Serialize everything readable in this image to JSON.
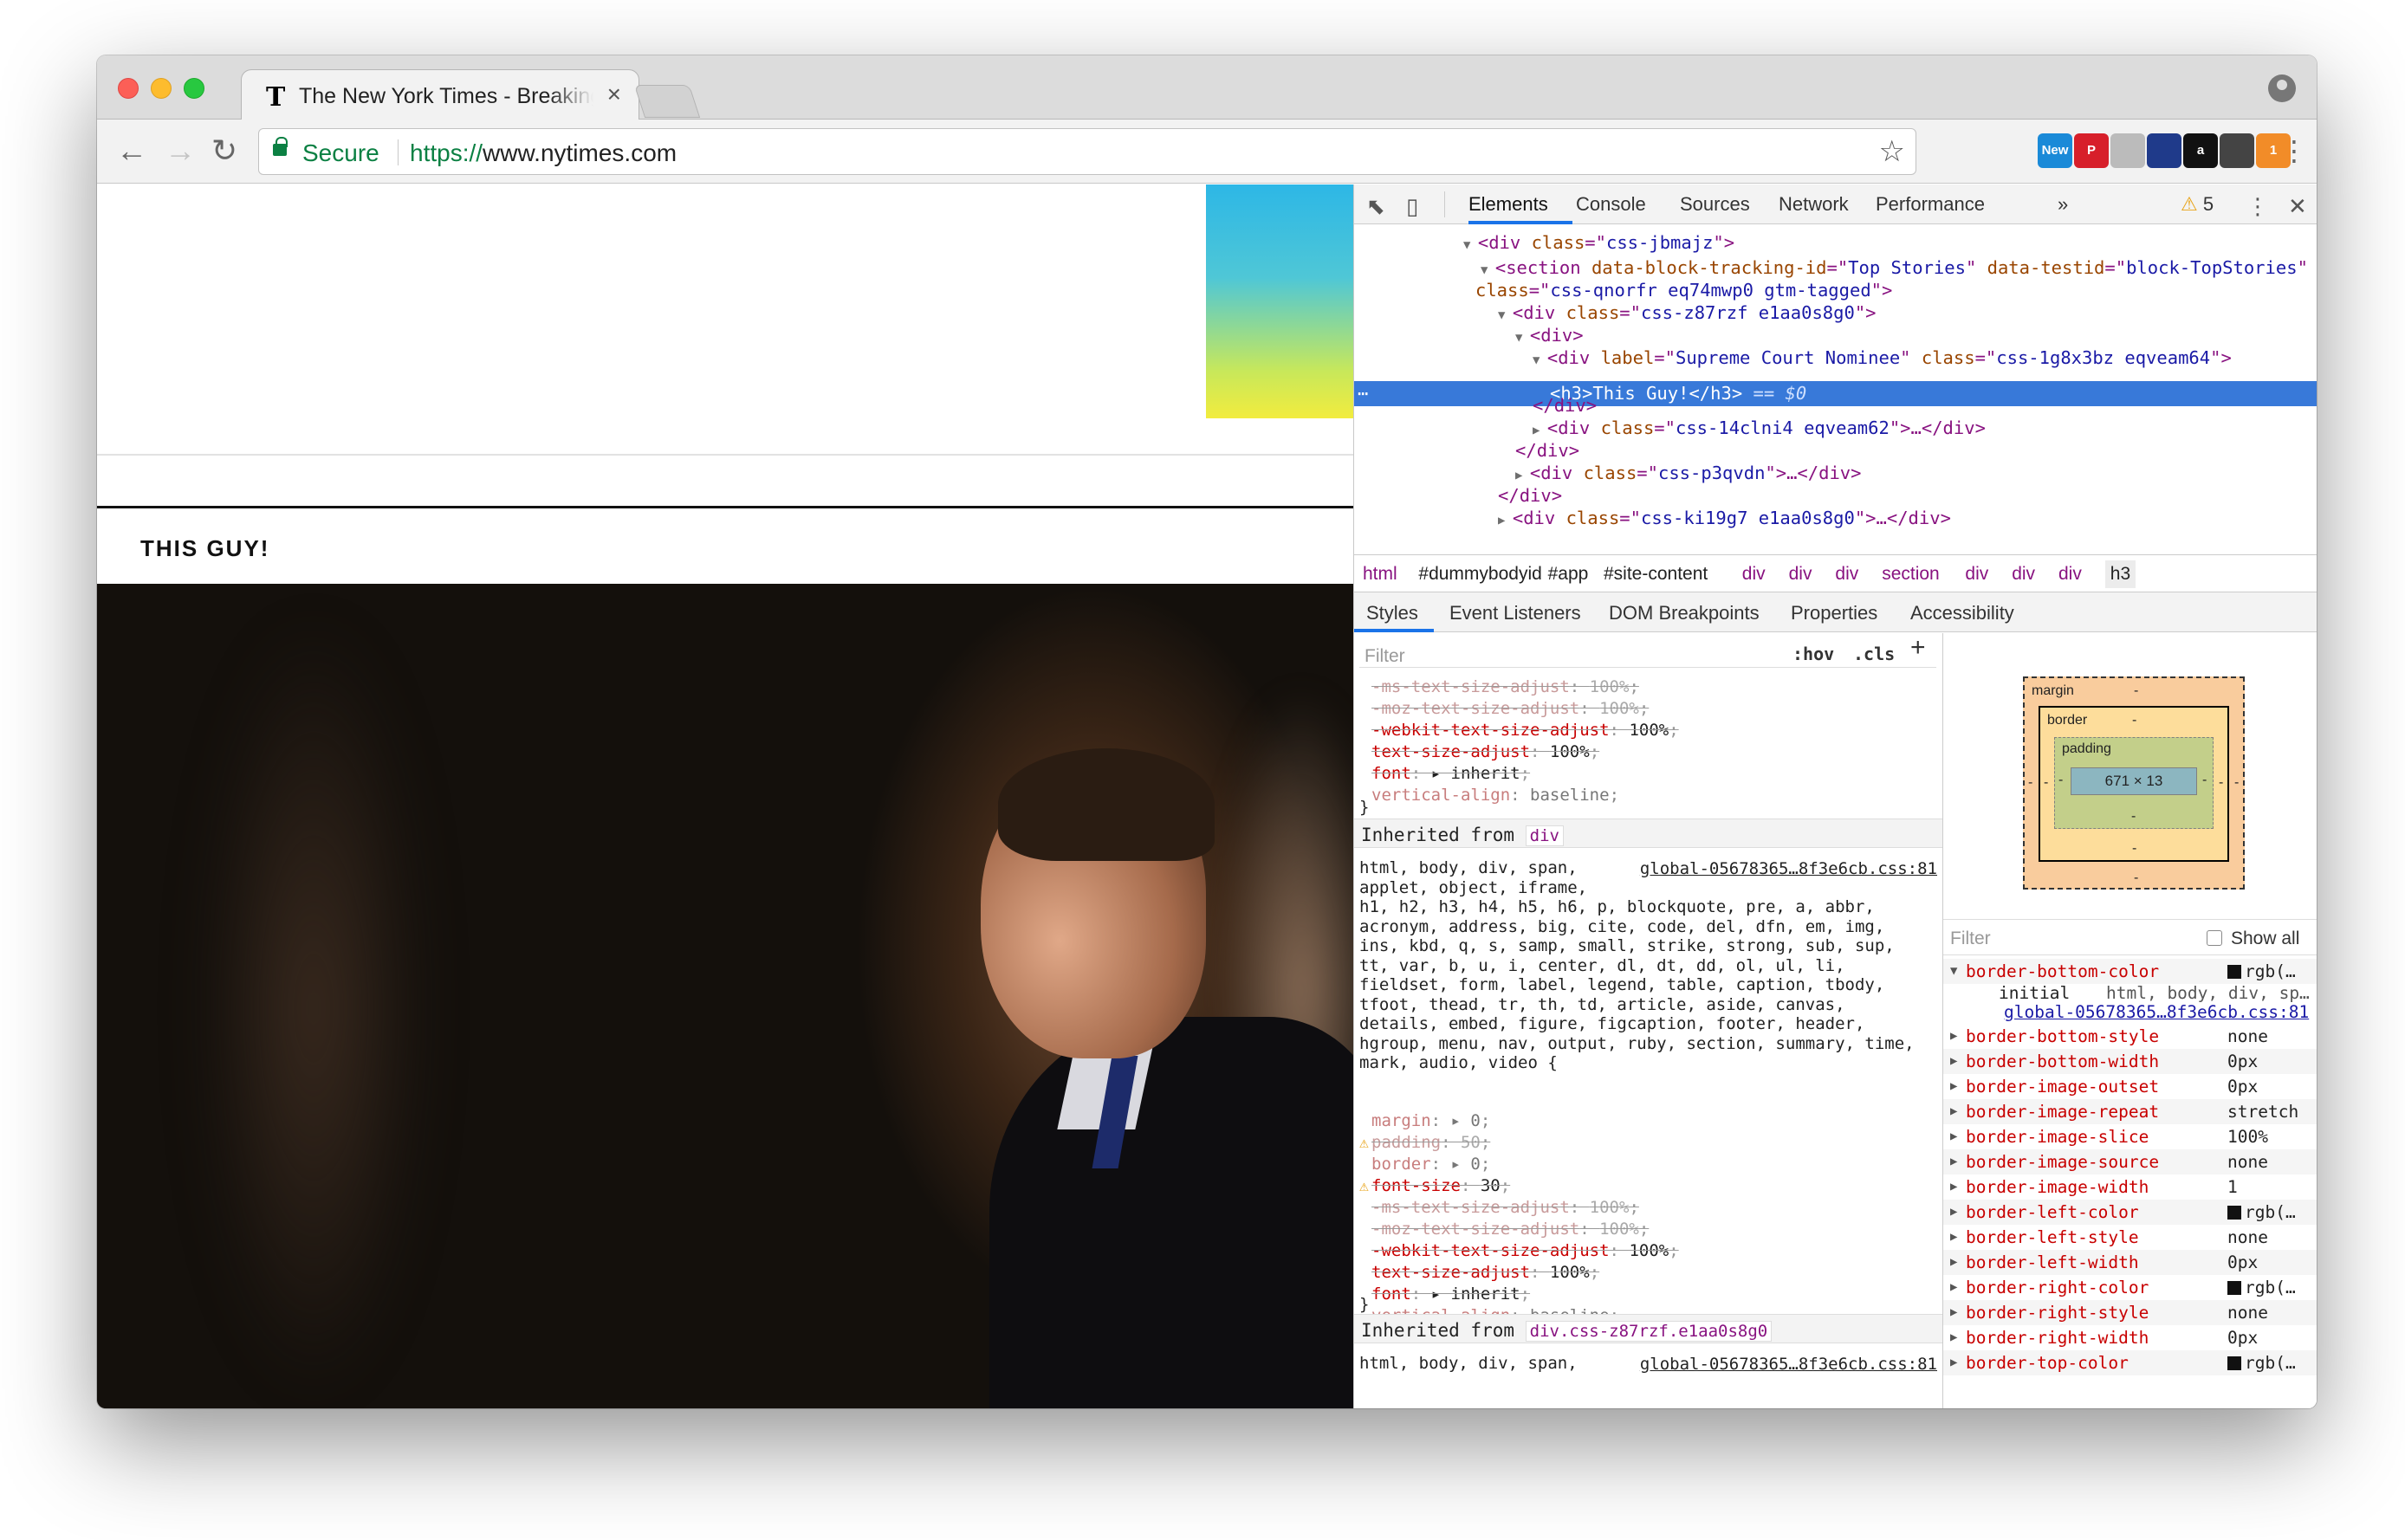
{
  "browser": {
    "tab_title": "The New York Times - Breaking News",
    "tab_favicon": "T",
    "secure_label": "Secure",
    "url_scheme": "https://",
    "url_host": "www.nytimes.com",
    "extensions": [
      {
        "name": "new-extension-icon",
        "label": "New",
        "color": "#1a8ad8"
      },
      {
        "name": "pinterest-icon",
        "label": "P",
        "color": "#d71f2a"
      },
      {
        "name": "drive-icon",
        "label": "",
        "color": "#bbbbbb"
      },
      {
        "name": "flag-extension-icon",
        "label": "",
        "color": "#1f3a8a"
      },
      {
        "name": "amazon-assistant-icon",
        "label": "a",
        "color": "#111111"
      },
      {
        "name": "chat-extension-icon",
        "label": "",
        "color": "#444444"
      },
      {
        "name": "orange-extension-icon",
        "label": "1",
        "color": "#f28c28"
      }
    ]
  },
  "page": {
    "headline": "THIS GUY!"
  },
  "devtools": {
    "tabs": [
      "Elements",
      "Console",
      "Sources",
      "Network",
      "Performance",
      "»"
    ],
    "warning_count": "5",
    "dom_lines": [
      {
        "indent": 0,
        "tri": "▼",
        "parts": [
          [
            "p",
            "<"
          ],
          [
            "t",
            "div"
          ],
          [
            "a",
            " class"
          ],
          [
            "p",
            "=\""
          ],
          [
            "v",
            "css-jbmajz"
          ],
          [
            "p",
            "\">"
          ]
        ]
      },
      {
        "indent": 1,
        "tri": "▼",
        "parts": [
          [
            "p",
            "<"
          ],
          [
            "t",
            "section"
          ],
          [
            "a",
            " data-block-tracking-id"
          ],
          [
            "p",
            "=\""
          ],
          [
            "v",
            "Top Stories"
          ],
          [
            "p",
            "\""
          ],
          [
            "a",
            " data-testid"
          ],
          [
            "p",
            "=\""
          ],
          [
            "v",
            "block-TopStories"
          ],
          [
            "p",
            "\""
          ]
        ]
      },
      {
        "indent": 1,
        "tri": "",
        "parts": [
          [
            "a",
            "class"
          ],
          [
            "p",
            "=\""
          ],
          [
            "v",
            "css-qnorfr eq74mwp0 gtm-tagged"
          ],
          [
            "p",
            "\">"
          ]
        ]
      },
      {
        "indent": 2,
        "tri": "▼",
        "parts": [
          [
            "p",
            "<"
          ],
          [
            "t",
            "div"
          ],
          [
            "a",
            " class"
          ],
          [
            "p",
            "=\""
          ],
          [
            "v",
            "css-z87rzf e1aa0s8g0"
          ],
          [
            "p",
            "\">"
          ]
        ]
      },
      {
        "indent": 3,
        "tri": "▼",
        "parts": [
          [
            "p",
            "<"
          ],
          [
            "t",
            "div"
          ],
          [
            "p",
            ">"
          ]
        ]
      },
      {
        "indent": 4,
        "tri": "▼",
        "parts": [
          [
            "p",
            "<"
          ],
          [
            "t",
            "div"
          ],
          [
            "a",
            " label"
          ],
          [
            "p",
            "=\""
          ],
          [
            "v",
            "Supreme Court Nominee"
          ],
          [
            "p",
            "\""
          ],
          [
            "a",
            " class"
          ],
          [
            "p",
            "=\""
          ],
          [
            "v",
            "css-1g8x3bz eqveam64"
          ],
          [
            "p",
            "\">"
          ]
        ]
      },
      {
        "indent": 5,
        "tri": "",
        "selected": true,
        "parts": [
          [
            "p",
            "<h3>This Guy!</h3>"
          ],
          [
            "p",
            " == $0"
          ]
        ]
      },
      {
        "indent": 4,
        "tri": "",
        "parts": [
          [
            "p",
            "</"
          ],
          [
            "t",
            "div"
          ],
          [
            "p",
            ">"
          ]
        ]
      },
      {
        "indent": 4,
        "tri": "▶",
        "parts": [
          [
            "p",
            "<"
          ],
          [
            "t",
            "div"
          ],
          [
            "a",
            " class"
          ],
          [
            "p",
            "=\""
          ],
          [
            "v",
            "css-14clni4 eqveam62"
          ],
          [
            "p",
            "\">…</"
          ],
          [
            "t",
            "div"
          ],
          [
            "p",
            ">"
          ]
        ]
      },
      {
        "indent": 3,
        "tri": "",
        "parts": [
          [
            "p",
            "</"
          ],
          [
            "t",
            "div"
          ],
          [
            "p",
            ">"
          ]
        ]
      },
      {
        "indent": 3,
        "tri": "▶",
        "parts": [
          [
            "p",
            "<"
          ],
          [
            "t",
            "div"
          ],
          [
            "a",
            " class"
          ],
          [
            "p",
            "=\""
          ],
          [
            "v",
            "css-p3qvdn"
          ],
          [
            "p",
            "\">…</"
          ],
          [
            "t",
            "div"
          ],
          [
            "p",
            ">"
          ]
        ]
      },
      {
        "indent": 2,
        "tri": "",
        "parts": [
          [
            "p",
            "</"
          ],
          [
            "t",
            "div"
          ],
          [
            "p",
            ">"
          ]
        ]
      },
      {
        "indent": 2,
        "tri": "▶",
        "parts": [
          [
            "p",
            "<"
          ],
          [
            "t",
            "div"
          ],
          [
            "a",
            " class"
          ],
          [
            "p",
            "=\""
          ],
          [
            "v",
            "css-ki19g7 e1aa0s8g0"
          ],
          [
            "p",
            "\">…</"
          ],
          [
            "t",
            "div"
          ],
          [
            "p",
            ">"
          ]
        ]
      }
    ],
    "breadcrumbs": [
      "html",
      "#dummybodyid",
      "#app",
      "#site-content",
      "div",
      "div",
      "div",
      "section",
      "div",
      "div",
      "div",
      "h3"
    ],
    "subtabs": [
      "Styles",
      "Event Listeners",
      "DOM Breakpoints",
      "Properties",
      "Accessibility"
    ],
    "styles": {
      "filter_placeholder": "Filter",
      "hov": ":hov",
      "cls": ".cls",
      "block1": [
        {
          "prop": "-ms-text-size-adjust",
          "val": "100%",
          "cls": "ov"
        },
        {
          "prop": "-moz-text-size-adjust",
          "val": "100%",
          "cls": "ov"
        },
        {
          "prop": "-webkit-text-size-adjust",
          "val": "100%",
          "cls": "ov dark"
        },
        {
          "prop": "text-size-adjust",
          "val": "100%",
          "cls": "ov dark"
        },
        {
          "prop": "font",
          "val": "▸ inherit",
          "cls": "ov dark"
        },
        {
          "prop": "vertical-align",
          "val": "baseline",
          "cls": "faded"
        }
      ],
      "inherited1_label": "Inherited from",
      "inherited1_tag": "div",
      "source_link": "global-05678365…8f3e6cb.css:81",
      "selector_text": "html, body, div, span,\napplet, object, iframe,\nh1, h2, h3, h4, h5, h6, p, blockquote, pre, a, abbr,\nacronym, address, big, cite, code, del, dfn, em, img,\nins, kbd, q, s, samp, small, strike, strong, sub, sup,\ntt, var, b, u, i, center, dl, dt, dd, ol, ul, li,\nfieldset, form, label, legend, table, caption, tbody,\ntfoot, thead, tr, th, td, article, aside, canvas,\ndetails, embed, figure, figcaption, footer, header,\nhgroup, menu, nav, output, ruby, section, summary, time,\nmark, audio, video {",
      "block2": [
        {
          "prop": "margin",
          "val": "▸ 0",
          "cls": "faded"
        },
        {
          "prop": "padding",
          "val": "50",
          "cls": "ov warn"
        },
        {
          "prop": "border",
          "val": "▸ 0",
          "cls": "faded"
        },
        {
          "prop": "font-size",
          "val": "30",
          "cls": "ov dark warn"
        },
        {
          "prop": "-ms-text-size-adjust",
          "val": "100%",
          "cls": "ov"
        },
        {
          "prop": "-moz-text-size-adjust",
          "val": "100%",
          "cls": "ov"
        },
        {
          "prop": "-webkit-text-size-adjust",
          "val": "100%",
          "cls": "ov dark"
        },
        {
          "prop": "text-size-adjust",
          "val": "100%",
          "cls": "ov dark"
        },
        {
          "prop": "font",
          "val": "▸ inherit",
          "cls": "ov dark"
        },
        {
          "prop": "vertical-align",
          "val": "baseline",
          "cls": "faded"
        }
      ],
      "close_brace": "}",
      "inherited2_label": "Inherited from",
      "inherited2_tag": "div.css-z87rzf.e1aa0s8g0",
      "selector2_text": "html, body, div, span,"
    },
    "boxmodel": {
      "margin_label": "margin",
      "border_label": "border",
      "padding_label": "padding",
      "dash": "-",
      "content_size": "671 × 13"
    },
    "computed": {
      "filter_placeholder": "Filter",
      "show_all": "Show all",
      "expanded_initial": "initial",
      "expanded_selectors": "html, body, div, sp…",
      "expanded_link": "global-05678365…8f3e6cb.css:81",
      "props": [
        {
          "name": "border-bottom-color",
          "value": "rgb(…",
          "swatch": true,
          "expanded": true
        },
        {
          "name": "border-bottom-style",
          "value": "none"
        },
        {
          "name": "border-bottom-width",
          "value": "0px"
        },
        {
          "name": "border-image-outset",
          "value": "0px"
        },
        {
          "name": "border-image-repeat",
          "value": "stretch"
        },
        {
          "name": "border-image-slice",
          "value": "100%"
        },
        {
          "name": "border-image-source",
          "value": "none"
        },
        {
          "name": "border-image-width",
          "value": "1"
        },
        {
          "name": "border-left-color",
          "value": "rgb(…",
          "swatch": true
        },
        {
          "name": "border-left-style",
          "value": "none"
        },
        {
          "name": "border-left-width",
          "value": "0px"
        },
        {
          "name": "border-right-color",
          "value": "rgb(…",
          "swatch": true
        },
        {
          "name": "border-right-style",
          "value": "none"
        },
        {
          "name": "border-right-width",
          "value": "0px"
        },
        {
          "name": "border-top-color",
          "value": "rgb(…",
          "swatch": true
        }
      ]
    }
  },
  "colors": {
    "selection": "#3879d9",
    "tag": "#881280",
    "attr": "#994500",
    "value": "#1a1aa6",
    "property": "#c80000",
    "secure": "#0b8043"
  }
}
